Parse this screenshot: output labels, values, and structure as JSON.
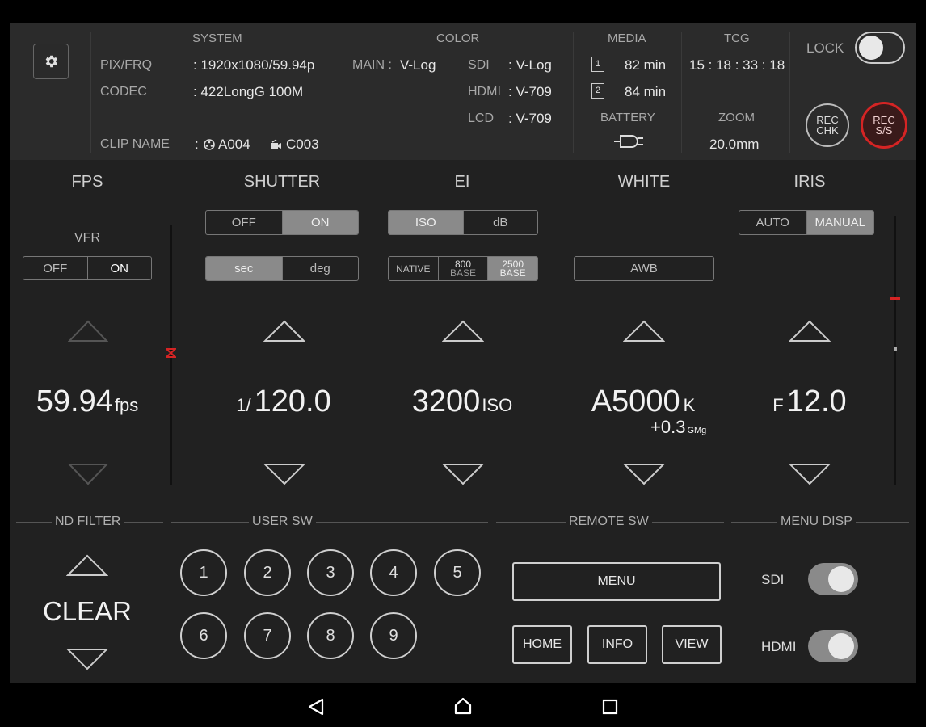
{
  "header": {
    "system": {
      "title": "SYSTEM",
      "pix_frq_label": "PIX/FRQ",
      "pix_frq_value": ": 1920x1080/59.94p",
      "codec_label": "CODEC",
      "codec_value": ": 422LongG 100M",
      "clip_name_label": "CLIP NAME",
      "clip_sep": ":",
      "clip_a": "A004",
      "clip_c": "C003"
    },
    "color": {
      "title": "COLOR",
      "main_label": "MAIN :",
      "main_value": "V-Log",
      "sdi_label": "SDI",
      "sdi_value": ": V-Log",
      "hdmi_label": "HDMI",
      "hdmi_value": ": V-709",
      "lcd_label": "LCD",
      "lcd_value": ": V-709"
    },
    "media": {
      "title": "MEDIA",
      "slot1_num": "1",
      "slot1_value": "82 min",
      "slot2_num": "2",
      "slot2_value": "84 min",
      "battery_label": "BATTERY"
    },
    "tcg": {
      "title": "TCG",
      "value": "15 : 18 : 33 : 18",
      "zoom_label": "ZOOM",
      "zoom_value": "20.0mm"
    },
    "lock_label": "LOCK",
    "rec_chk_label": "REC\nCHK",
    "rec_ss_label": "REC\nS/S"
  },
  "controls": {
    "fps": {
      "title": "FPS",
      "vfr_label": "VFR",
      "vfr_off": "OFF",
      "vfr_on": "ON",
      "value": "59.94",
      "unit": "fps"
    },
    "shutter": {
      "title": "SHUTTER",
      "off": "OFF",
      "on": "ON",
      "sec": "sec",
      "deg": "deg",
      "prefix": "1/",
      "value": "120.0"
    },
    "ei": {
      "title": "EI",
      "iso": "ISO",
      "db": "dB",
      "native": "NATIVE",
      "base800_top": "800",
      "base800_bottom": "BASE",
      "base2500_top": "2500",
      "base2500_bottom": "BASE",
      "value": "3200",
      "unit": "ISO"
    },
    "white": {
      "title": "WHITE",
      "awb": "AWB",
      "value": "A5000",
      "unit": "K",
      "gmg_value": "+0.3",
      "gmg_unit": "GMg"
    },
    "iris": {
      "title": "IRIS",
      "auto": "AUTO",
      "manual": "MANUAL",
      "prefix": "F",
      "value": "12.0"
    }
  },
  "bottom": {
    "nd_filter": {
      "title": "ND FILTER",
      "value": "CLEAR"
    },
    "user_sw": {
      "title": "USER SW",
      "buttons": [
        "1",
        "2",
        "3",
        "4",
        "5",
        "6",
        "7",
        "8",
        "9"
      ]
    },
    "remote_sw": {
      "title": "REMOTE SW",
      "menu": "MENU",
      "home": "HOME",
      "info": "INFO",
      "view": "VIEW"
    },
    "menu_disp": {
      "title": "MENU DISP",
      "sdi": "SDI",
      "hdmi": "HDMI"
    }
  },
  "colors": {
    "accent_red": "#d52424",
    "active_segment": "#8a8a8a"
  }
}
